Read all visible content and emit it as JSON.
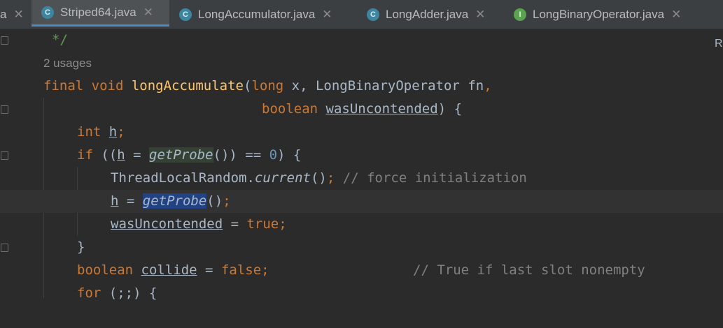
{
  "tabs": [
    {
      "label": "a",
      "icon": "",
      "active": false
    },
    {
      "label": "Striped64.java",
      "icon": "C",
      "active": true
    },
    {
      "label": "LongAccumulator.java",
      "icon": "C",
      "active": false
    },
    {
      "label": "LongAdder.java",
      "icon": "C",
      "active": false
    },
    {
      "label": "LongBinaryOperator.java",
      "icon": "I",
      "active": false
    }
  ],
  "close_glyph": "✕",
  "right_letter": "R",
  "code": {
    "doc_end": "*/",
    "usages": "2 usages",
    "l1": {
      "kw1": "final void ",
      "fn": "longAccumulate",
      "p1": "(",
      "kw2": "long",
      "rest": " x, LongBinaryOperator fn",
      "comma": ","
    },
    "l2": {
      "kw": "boolean",
      "sp": " ",
      "var": "wasUncontended",
      "rest": ") {"
    },
    "l3": {
      "kw": "int",
      "sp": " ",
      "var": "h",
      "semi": ";"
    },
    "l4": {
      "kw": "if",
      "p1": " ((",
      "var": "h",
      "eq": " = ",
      "call": "getProbe",
      "p2": "()) == ",
      "num": "0",
      "p3": ") {"
    },
    "l5": {
      "cls": "ThreadLocalRandom.",
      "call": "current",
      "p": "()",
      "semi": ";",
      "cmt": " // force initialization"
    },
    "l6": {
      "var": "h",
      "eq": " = ",
      "call": "getProbe",
      "p": "()",
      "semi": ";"
    },
    "l7": {
      "var": "wasUncontended",
      "eq": " = ",
      "kw": "true",
      "semi": ";"
    },
    "l8": {
      "brace": "}"
    },
    "l9": {
      "kw": "boolean",
      "sp": " ",
      "var": "collide",
      "eq": " = ",
      "kw2": "false",
      "semi": ";",
      "cmt": "// True if last slot nonempty"
    },
    "l10": {
      "kw": "for",
      "rest": " (;;) {"
    }
  }
}
